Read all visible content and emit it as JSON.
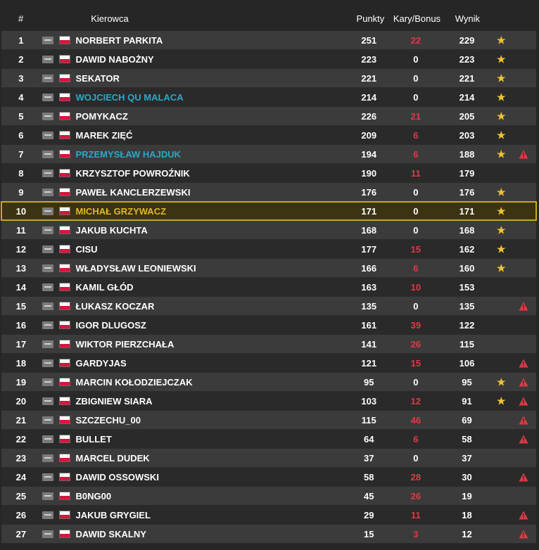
{
  "columns": {
    "pos": "#",
    "driver": "Kierowca",
    "points": "Punkty",
    "penalty": "Kary/Bonus",
    "result": "Wynik"
  },
  "colors": {
    "penalty_red": "#dd3b45",
    "name_blue": "#2aa9c9",
    "highlight_gold": "#e3b825",
    "star_yellow": "#f0c330"
  },
  "rows": [
    {
      "pos": "1",
      "name": "NORBERT PARKITA",
      "points": "251",
      "penalty": "22",
      "result": "229",
      "star": true,
      "warn": false,
      "style": ""
    },
    {
      "pos": "2",
      "name": "DAWID NABOŻNY",
      "points": "223",
      "penalty": "0",
      "result": "223",
      "star": true,
      "warn": false,
      "style": ""
    },
    {
      "pos": "3",
      "name": "SEKATOR",
      "points": "221",
      "penalty": "0",
      "result": "221",
      "star": true,
      "warn": false,
      "style": ""
    },
    {
      "pos": "4",
      "name": "WOJCIECH QU MALACA",
      "points": "214",
      "penalty": "0",
      "result": "214",
      "star": true,
      "warn": false,
      "style": "blue"
    },
    {
      "pos": "5",
      "name": "POMYKACZ",
      "points": "226",
      "penalty": "21",
      "result": "205",
      "star": true,
      "warn": false,
      "style": ""
    },
    {
      "pos": "6",
      "name": "MAREK ZIĘĆ",
      "points": "209",
      "penalty": "6",
      "result": "203",
      "star": true,
      "warn": false,
      "style": ""
    },
    {
      "pos": "7",
      "name": "PRZEMYSŁAW HAJDUK",
      "points": "194",
      "penalty": "6",
      "result": "188",
      "star": true,
      "warn": true,
      "style": "blue"
    },
    {
      "pos": "8",
      "name": "KRZYSZTOF POWROŹNIK",
      "points": "190",
      "penalty": "11",
      "result": "179",
      "star": false,
      "warn": false,
      "style": ""
    },
    {
      "pos": "9",
      "name": "PAWEŁ KANCLERZEWSKI",
      "points": "176",
      "penalty": "0",
      "result": "176",
      "star": true,
      "warn": false,
      "style": ""
    },
    {
      "pos": "10",
      "name": "MICHAŁ GRZYWACZ",
      "points": "171",
      "penalty": "0",
      "result": "171",
      "star": true,
      "warn": false,
      "style": "gold"
    },
    {
      "pos": "11",
      "name": "JAKUB KUCHTA",
      "points": "168",
      "penalty": "0",
      "result": "168",
      "star": true,
      "warn": false,
      "style": ""
    },
    {
      "pos": "12",
      "name": "CISU",
      "points": "177",
      "penalty": "15",
      "result": "162",
      "star": true,
      "warn": false,
      "style": ""
    },
    {
      "pos": "13",
      "name": "WŁADYSŁAW LEONIEWSKI",
      "points": "166",
      "penalty": "6",
      "result": "160",
      "star": true,
      "warn": false,
      "style": ""
    },
    {
      "pos": "14",
      "name": "KAMIL GŁÓD",
      "points": "163",
      "penalty": "10",
      "result": "153",
      "star": false,
      "warn": false,
      "style": ""
    },
    {
      "pos": "15",
      "name": "ŁUKASZ KOCZAR",
      "points": "135",
      "penalty": "0",
      "result": "135",
      "star": false,
      "warn": true,
      "style": ""
    },
    {
      "pos": "16",
      "name": "IGOR DLUGOSZ",
      "points": "161",
      "penalty": "39",
      "result": "122",
      "star": false,
      "warn": false,
      "style": ""
    },
    {
      "pos": "17",
      "name": "WIKTOR PIERZCHAŁA",
      "points": "141",
      "penalty": "26",
      "result": "115",
      "star": false,
      "warn": false,
      "style": ""
    },
    {
      "pos": "18",
      "name": "GARDYJAS",
      "points": "121",
      "penalty": "15",
      "result": "106",
      "star": false,
      "warn": true,
      "style": ""
    },
    {
      "pos": "19",
      "name": "MARCIN KOŁODZIEJCZAK",
      "points": "95",
      "penalty": "0",
      "result": "95",
      "star": true,
      "warn": true,
      "style": ""
    },
    {
      "pos": "20",
      "name": "ZBIGNIEW SIARA",
      "points": "103",
      "penalty": "12",
      "result": "91",
      "star": true,
      "warn": true,
      "style": ""
    },
    {
      "pos": "21",
      "name": "SZCZECHU_00",
      "points": "115",
      "penalty": "46",
      "result": "69",
      "star": false,
      "warn": true,
      "style": ""
    },
    {
      "pos": "22",
      "name": "BULLET",
      "points": "64",
      "penalty": "6",
      "result": "58",
      "star": false,
      "warn": true,
      "style": ""
    },
    {
      "pos": "23",
      "name": "MARCEL DUDEK",
      "points": "37",
      "penalty": "0",
      "result": "37",
      "star": false,
      "warn": false,
      "style": ""
    },
    {
      "pos": "24",
      "name": "DAWID OSSOWSKI",
      "points": "58",
      "penalty": "28",
      "result": "30",
      "star": false,
      "warn": true,
      "style": ""
    },
    {
      "pos": "25",
      "name": "B0NG00",
      "points": "45",
      "penalty": "26",
      "result": "19",
      "star": false,
      "warn": false,
      "style": ""
    },
    {
      "pos": "26",
      "name": "JAKUB GRYGIEL",
      "points": "29",
      "penalty": "11",
      "result": "18",
      "star": false,
      "warn": true,
      "style": ""
    },
    {
      "pos": "27",
      "name": "DAWID SKALNY",
      "points": "15",
      "penalty": "3",
      "result": "12",
      "star": false,
      "warn": true,
      "style": ""
    }
  ]
}
